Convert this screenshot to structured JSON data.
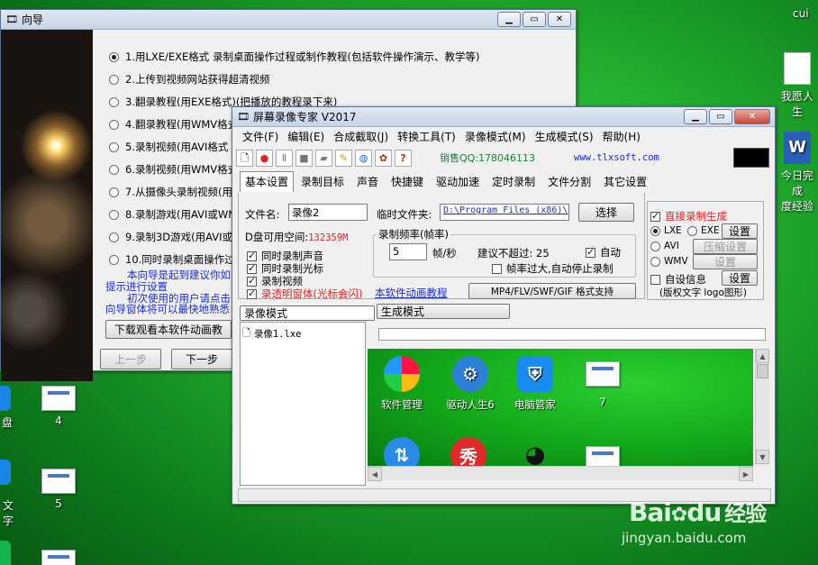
{
  "desktop": {
    "top_right_user": "cui",
    "icons_right": [
      {
        "label": "我愿人生"
      },
      {
        "label": "今日完成"
      },
      {
        "label": "度经验"
      }
    ],
    "icons_left": [
      {
        "label": "盘"
      },
      {
        "label": "4"
      },
      {
        "label": "文字"
      },
      {
        "label": "5"
      }
    ]
  },
  "wizard": {
    "title": "向导",
    "options": [
      "1.用LXE/EXE格式 录制桌面操作过程或制作教程(包括软件操作演示、教学等)",
      "2.上传到视频网站获得超清视频",
      "3.翻录教程(用EXE格式)(把播放的教程录下来)",
      "4.翻录教程(用WMV格式",
      "5.录制视频(用AVI格式",
      "6.录制视频(用WMV格式",
      "7.从摄像头录制视频(用",
      "8.录制游戏(用AVI或WM",
      "9.录制3D游戏(用AVI或",
      "10.同时录制桌面操作过"
    ],
    "hint_lines": [
      "本向导是起到建议你如",
      "提示进行设置",
      "初次使用的用户请点击",
      "向导窗体将可以最快地熟悉"
    ],
    "download_button": "下载观看本软件动画教",
    "prev_button": "上一步",
    "next_button": "下一步"
  },
  "recorder": {
    "title": "屏幕录像专家 V2017",
    "menu": [
      "文件(F)",
      "编辑(E)",
      "合成截取(J)",
      "转换工具(T)",
      "录像模式(M)",
      "生成模式(S)",
      "帮助(H)"
    ],
    "sales_qq": "销售QQ:178046113",
    "website": "www.tlxsoft.com",
    "tabs": [
      "基本设置",
      "录制目标",
      "声音",
      "快捷键",
      "驱动加速",
      "定时录制",
      "文件分割",
      "其它设置"
    ],
    "filename_label": "文件名:",
    "filename_value": "录像2",
    "temp_folder_label": "临时文件夹:",
    "temp_folder_value": "D:\\Program Files (x86)\\",
    "select_button": "选择",
    "disk_space_label": "D盘可用空间:",
    "disk_space_value": "132359M",
    "rate_group_label": "录制频率(帧率)",
    "fps_value": "5",
    "fps_unit": "帧/秒",
    "suggest_text": "建议不超过: 25",
    "auto_label": "自动",
    "auto_stop_label": "帧率过大,自动停止录制",
    "checks": [
      "同时录制声音",
      "同时录制光标",
      "录制视频"
    ],
    "transparent_label": "录透明窗体(光标会闪)",
    "tutorial_link": "本软件动画教程",
    "format_button": "MP4/FLV/SWF/GIF  格式支持",
    "direct_gen_label": "直接录制生成",
    "fmt_lxe": "LXE",
    "fmt_exe": "EXE",
    "fmt_avi": "AVI",
    "fmt_wmv": "WMV",
    "settings_button": "设置",
    "compress_button": "压缩设置",
    "settings2_button": "设置",
    "custom_info_label": "自设信息",
    "settings3_button": "设置",
    "copyright_text": "(版权文字 logo图形)",
    "mode_tab_record": "录像模式",
    "mode_tab_generate": "生成模式",
    "file_list": [
      "录像1.lxe"
    ],
    "preview_apps": [
      {
        "label": "软件管理"
      },
      {
        "label": "驱动人生6"
      },
      {
        "label": "电脑管家"
      },
      {
        "label": "7"
      }
    ]
  },
  "watermark": {
    "brand": "Bai",
    "brand2": "du",
    "brand_cn": "经验",
    "url": "jingyan.baidu.com"
  }
}
